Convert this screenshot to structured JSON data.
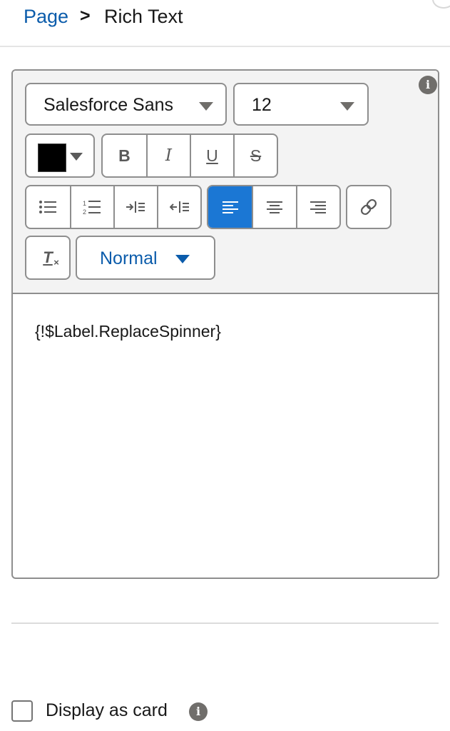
{
  "breadcrumb": {
    "parent": "Page",
    "separator": ">",
    "current": "Rich Text"
  },
  "toolbar": {
    "font_family": "Salesforce Sans",
    "font_size": "12",
    "text_color": "#000000",
    "bold": "B",
    "italic": "I",
    "underline": "U",
    "strikethrough": "S",
    "clear_format": "T",
    "block_format": "Normal",
    "active_alignment": "left",
    "accent_color": "#1b77d4"
  },
  "editor": {
    "content": "{!$Label.ReplaceSpinner}"
  },
  "display_card": {
    "label": "Display as card",
    "checked": false
  },
  "info_glyph": "i"
}
